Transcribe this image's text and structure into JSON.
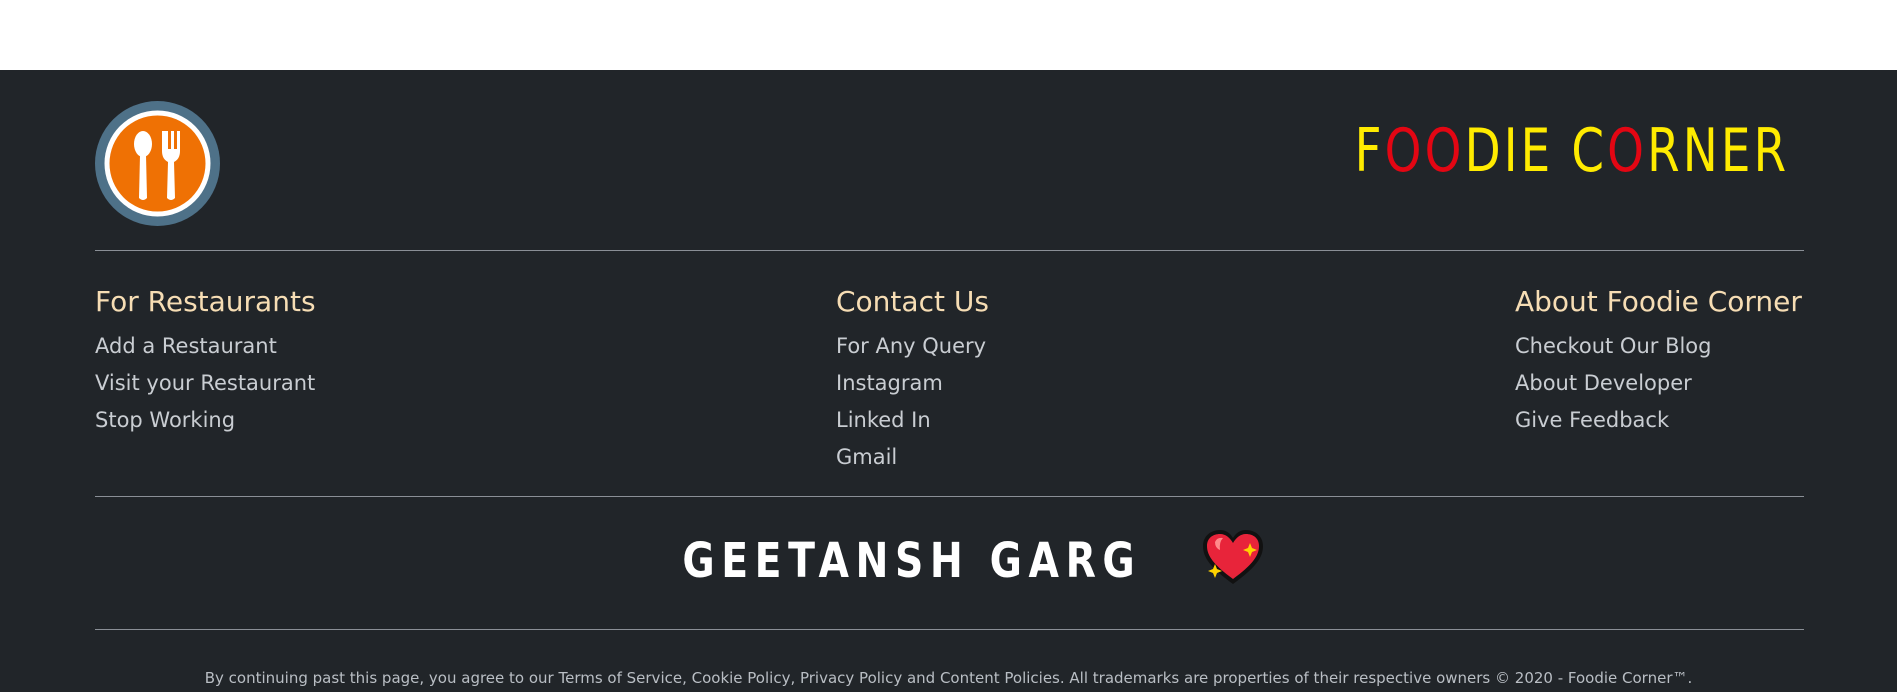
{
  "brand": {
    "letters": [
      {
        "ch": "F",
        "color": "#ffeb00"
      },
      {
        "ch": "O",
        "color": "#e30613"
      },
      {
        "ch": "O",
        "color": "#e30613"
      },
      {
        "ch": "D",
        "color": "#ffeb00"
      },
      {
        "ch": "I",
        "color": "#ffeb00"
      },
      {
        "ch": "E",
        "color": "#ffeb00"
      },
      {
        "ch": " ",
        "color": "#ffeb00"
      },
      {
        "ch": "C",
        "color": "#ffeb00"
      },
      {
        "ch": "O",
        "color": "#e30613"
      },
      {
        "ch": "R",
        "color": "#ffeb00"
      },
      {
        "ch": "N",
        "color": "#ffeb00"
      },
      {
        "ch": "E",
        "color": "#ffeb00"
      },
      {
        "ch": "R",
        "color": "#ffeb00"
      }
    ],
    "logo_icon": "spoon-fork-icon"
  },
  "columns": [
    {
      "title": "For Restaurants",
      "links": [
        "Add a Restaurant",
        "Visit your Restaurant",
        "Stop Working"
      ]
    },
    {
      "title": "Contact Us",
      "links": [
        "For Any Query",
        "Instagram",
        "Linked In",
        "Gmail"
      ]
    },
    {
      "title": "About Foodie Corner",
      "links": [
        "Checkout Our Blog",
        "About Developer",
        "Give Feedback"
      ]
    }
  ],
  "developer": {
    "name": "GEETANSH GARG",
    "icon": "sparkling-heart-icon"
  },
  "legal_text": "By continuing past this page, you agree to our Terms of Service, Cookie Policy, Privacy Policy and Content Policies. All trademarks are properties of their respective owners © 2020 - Foodie Corner™.",
  "colors": {
    "footer_bg": "#212529",
    "heading": "#f6ddb4",
    "brand_yellow": "#ffeb00",
    "brand_red": "#e30613"
  }
}
